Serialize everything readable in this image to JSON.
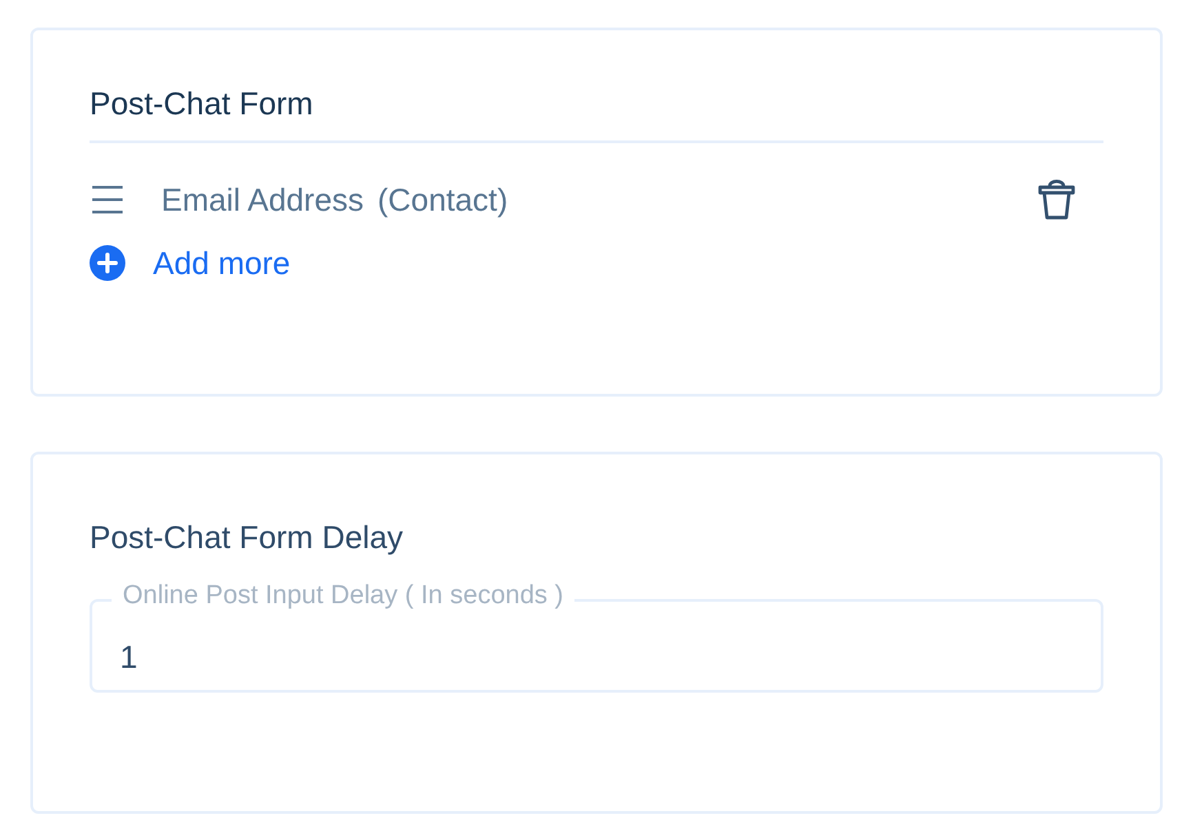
{
  "post_chat_form": {
    "title": "Post-Chat Form",
    "fields": [
      {
        "label": "Email Address",
        "source": "(Contact)"
      }
    ],
    "add_button": "Add more"
  },
  "delay": {
    "title": "Post-Chat Form Delay",
    "input": {
      "label": "Online Post Input Delay ( In seconds )",
      "value": "1"
    }
  }
}
